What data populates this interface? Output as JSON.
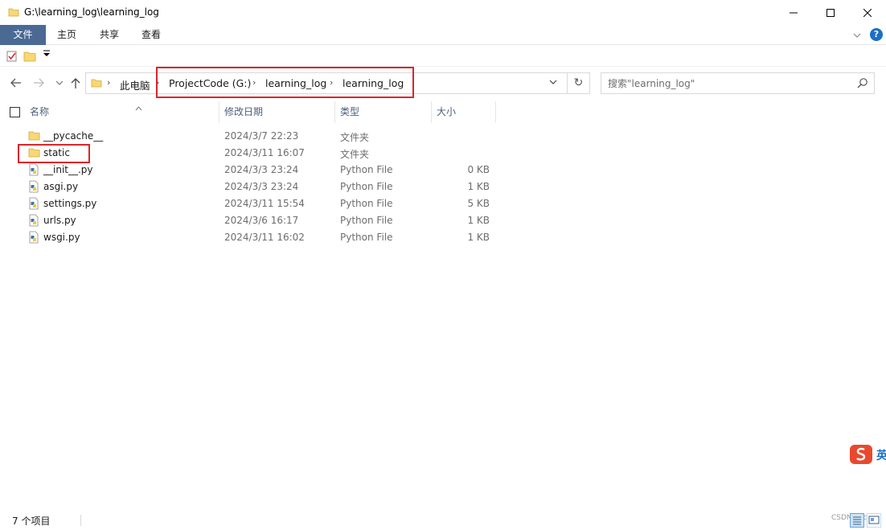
{
  "window": {
    "title": "G:\\learning_log\\learning_log"
  },
  "ribbon": {
    "tabs": [
      {
        "label": "文件"
      },
      {
        "label": "主页"
      },
      {
        "label": "共享"
      },
      {
        "label": "查看"
      }
    ],
    "help_label": "?"
  },
  "navigation": {
    "breadcrumbs": [
      {
        "label": "此电脑"
      },
      {
        "label": "ProjectCode (G:)"
      },
      {
        "label": "learning_log"
      },
      {
        "label": "learning_log"
      }
    ],
    "search_placeholder": "搜索\"learning_log\""
  },
  "columns": {
    "name": "名称",
    "date": "修改日期",
    "type": "类型",
    "size": "大小"
  },
  "files": [
    {
      "name": "__pycache__",
      "date": "2024/3/7 22:23",
      "type": "文件夹",
      "size": "",
      "icon": "folder-icon"
    },
    {
      "name": "static",
      "date": "2024/3/11 16:07",
      "type": "文件夹",
      "size": "",
      "icon": "folder-icon"
    },
    {
      "name": "__init__.py",
      "date": "2024/3/3 23:24",
      "type": "Python File",
      "size": "0 KB",
      "icon": "python-file-icon"
    },
    {
      "name": "asgi.py",
      "date": "2024/3/3 23:24",
      "type": "Python File",
      "size": "1 KB",
      "icon": "python-file-icon"
    },
    {
      "name": "settings.py",
      "date": "2024/3/11 15:54",
      "type": "Python File",
      "size": "5 KB",
      "icon": "python-file-icon"
    },
    {
      "name": "urls.py",
      "date": "2024/3/6 16:17",
      "type": "Python File",
      "size": "1 KB",
      "icon": "python-file-icon"
    },
    {
      "name": "wsgi.py",
      "date": "2024/3/11 16:02",
      "type": "Python File",
      "size": "1 KB",
      "icon": "python-file-icon"
    }
  ],
  "status": {
    "item_count": "7 个项目",
    "watermark": "CSDN@zc"
  },
  "colors": {
    "file_tab": "#4a6a94",
    "highlight_box": "#d9262b",
    "folder": "#f8d775"
  }
}
